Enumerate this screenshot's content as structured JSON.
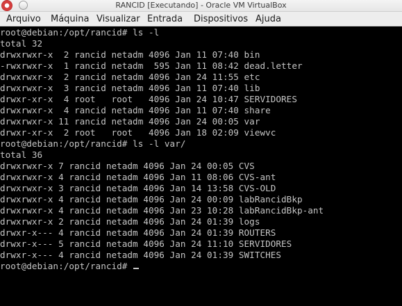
{
  "window": {
    "title": "RANCID [Executando] - Oracle VM VirtualBox",
    "icon": "virtualbox-app-icon",
    "control_icon": "window-menu-icon"
  },
  "menu": {
    "items": [
      "Arquivo",
      "Máquina",
      "Visualizar",
      "Entrada",
      "Dispositivos",
      "Ajuda"
    ]
  },
  "terminal": {
    "lines": [
      "root@debian:/opt/rancid# ls -l",
      "total 32",
      "drwxrwxr-x  2 rancid netadm 4096 Jan 11 07:40 bin",
      "-rwxrwxr-x  1 rancid netadm  595 Jan 11 08:42 dead.letter",
      "drwxrwxr-x  2 rancid netadm 4096 Jan 24 11:55 etc",
      "drwxrwxr-x  3 rancid netadm 4096 Jan 11 07:40 lib",
      "drwxr-xr-x  4 root   root   4096 Jan 24 10:47 SERVIDORES",
      "drwxrwxr-x  4 rancid netadm 4096 Jan 11 07:40 share",
      "drwxrwxr-x 11 rancid netadm 4096 Jan 24 00:05 var",
      "drwxr-xr-x  2 root   root   4096 Jan 18 02:09 viewvc",
      "root@debian:/opt/rancid# ls -l var/",
      "total 36",
      "drwxrwxr-x 7 rancid netadm 4096 Jan 24 00:05 CVS",
      "drwxrwxr-x 4 rancid netadm 4096 Jan 11 08:06 CVS-ant",
      "drwxrwxr-x 3 rancid netadm 4096 Jan 14 13:58 CVS-OLD",
      "drwxrwxr-x 4 rancid netadm 4096 Jan 24 00:09 labRancidBkp",
      "drwxrwxr-x 4 rancid netadm 4096 Jan 23 10:28 labRancidBkp-ant",
      "drwxrwxr-x 2 rancid netadm 4096 Jan 24 01:39 logs",
      "drwxr-x--- 4 rancid netadm 4096 Jan 24 01:39 ROUTERS",
      "drwxr-x--- 5 rancid netadm 4096 Jan 24 11:10 SERVIDORES",
      "drwxr-x--- 4 rancid netadm 4096 Jan 24 01:39 SWITCHES"
    ],
    "prompt": "root@debian:/opt/rancid# ",
    "text_color": "#c6c6c6",
    "background": "#000000"
  }
}
